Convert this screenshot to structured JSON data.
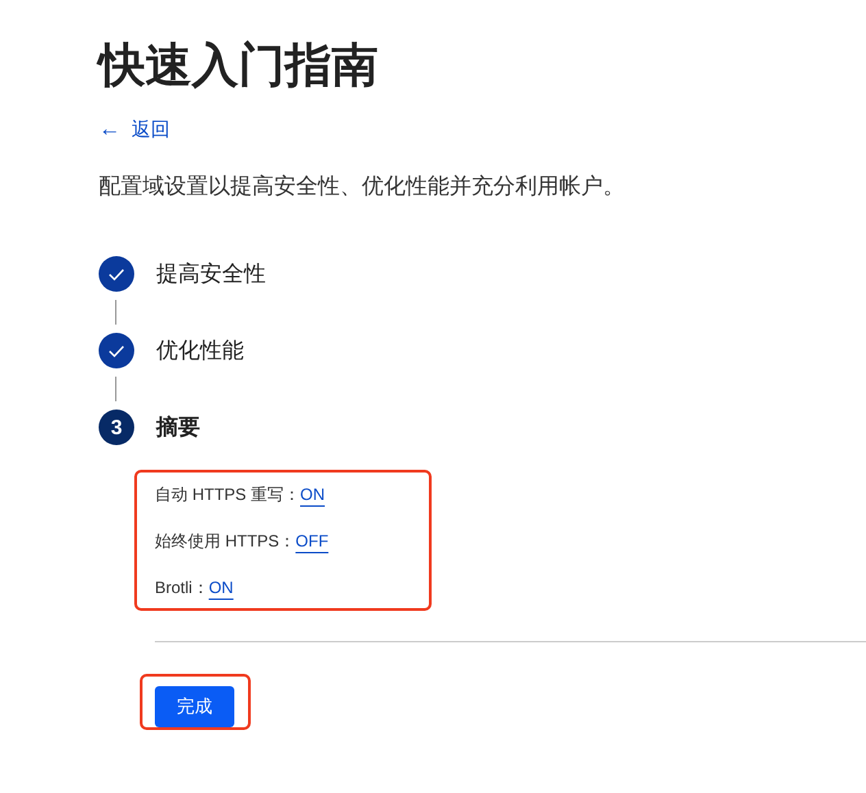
{
  "title": "快速入门指南",
  "back_link": {
    "icon": "←",
    "label": "返回"
  },
  "description": "配置域设置以提高安全性、优化性能并充分利用帐户。",
  "steps": [
    {
      "label": "提高安全性",
      "completed": true,
      "current": false
    },
    {
      "label": "优化性能",
      "completed": true,
      "current": false
    },
    {
      "label": "摘要",
      "completed": false,
      "current": true,
      "number": "3"
    }
  ],
  "summary": {
    "highlighted": true,
    "settings": [
      {
        "label": "自动 HTTPS 重写：",
        "value": "ON"
      },
      {
        "label": "始终使用 HTTPS：",
        "value": "OFF"
      },
      {
        "label": "Brotli：",
        "value": "ON"
      }
    ]
  },
  "finish_button": {
    "label": "完成",
    "highlighted": true
  }
}
